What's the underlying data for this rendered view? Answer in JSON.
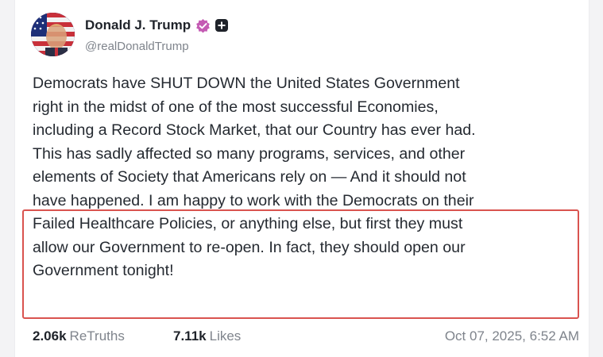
{
  "author": {
    "display_name": "Donald J. Trump",
    "handle": "@realDonaldTrump",
    "verified_icon": "verified-badge-icon",
    "verified_color": "#c45ab3"
  },
  "post": {
    "lines": [
      "Democrats have SHUT DOWN the United States Government",
      "right in the midst of one of the most successful Economies,",
      "including a Record Stock Market, that our Country has ever had.",
      "This has sadly affected so many programs, services, and other",
      "elements of Society that Americans rely on — And it should not",
      "have happened. I am happy to work with the Democrats on their",
      "Failed Healthcare Policies, or anything else, but first they must",
      "allow our Government to re-open. In fact, they should open our",
      "Government tonight!"
    ]
  },
  "highlight": {
    "color": "#d9534f"
  },
  "stats": {
    "retruths_count": "2.06k",
    "retruths_label": "ReTruths",
    "likes_count": "7.11k",
    "likes_label": "Likes"
  },
  "timestamp": "Oct 07, 2025, 6:52 AM"
}
